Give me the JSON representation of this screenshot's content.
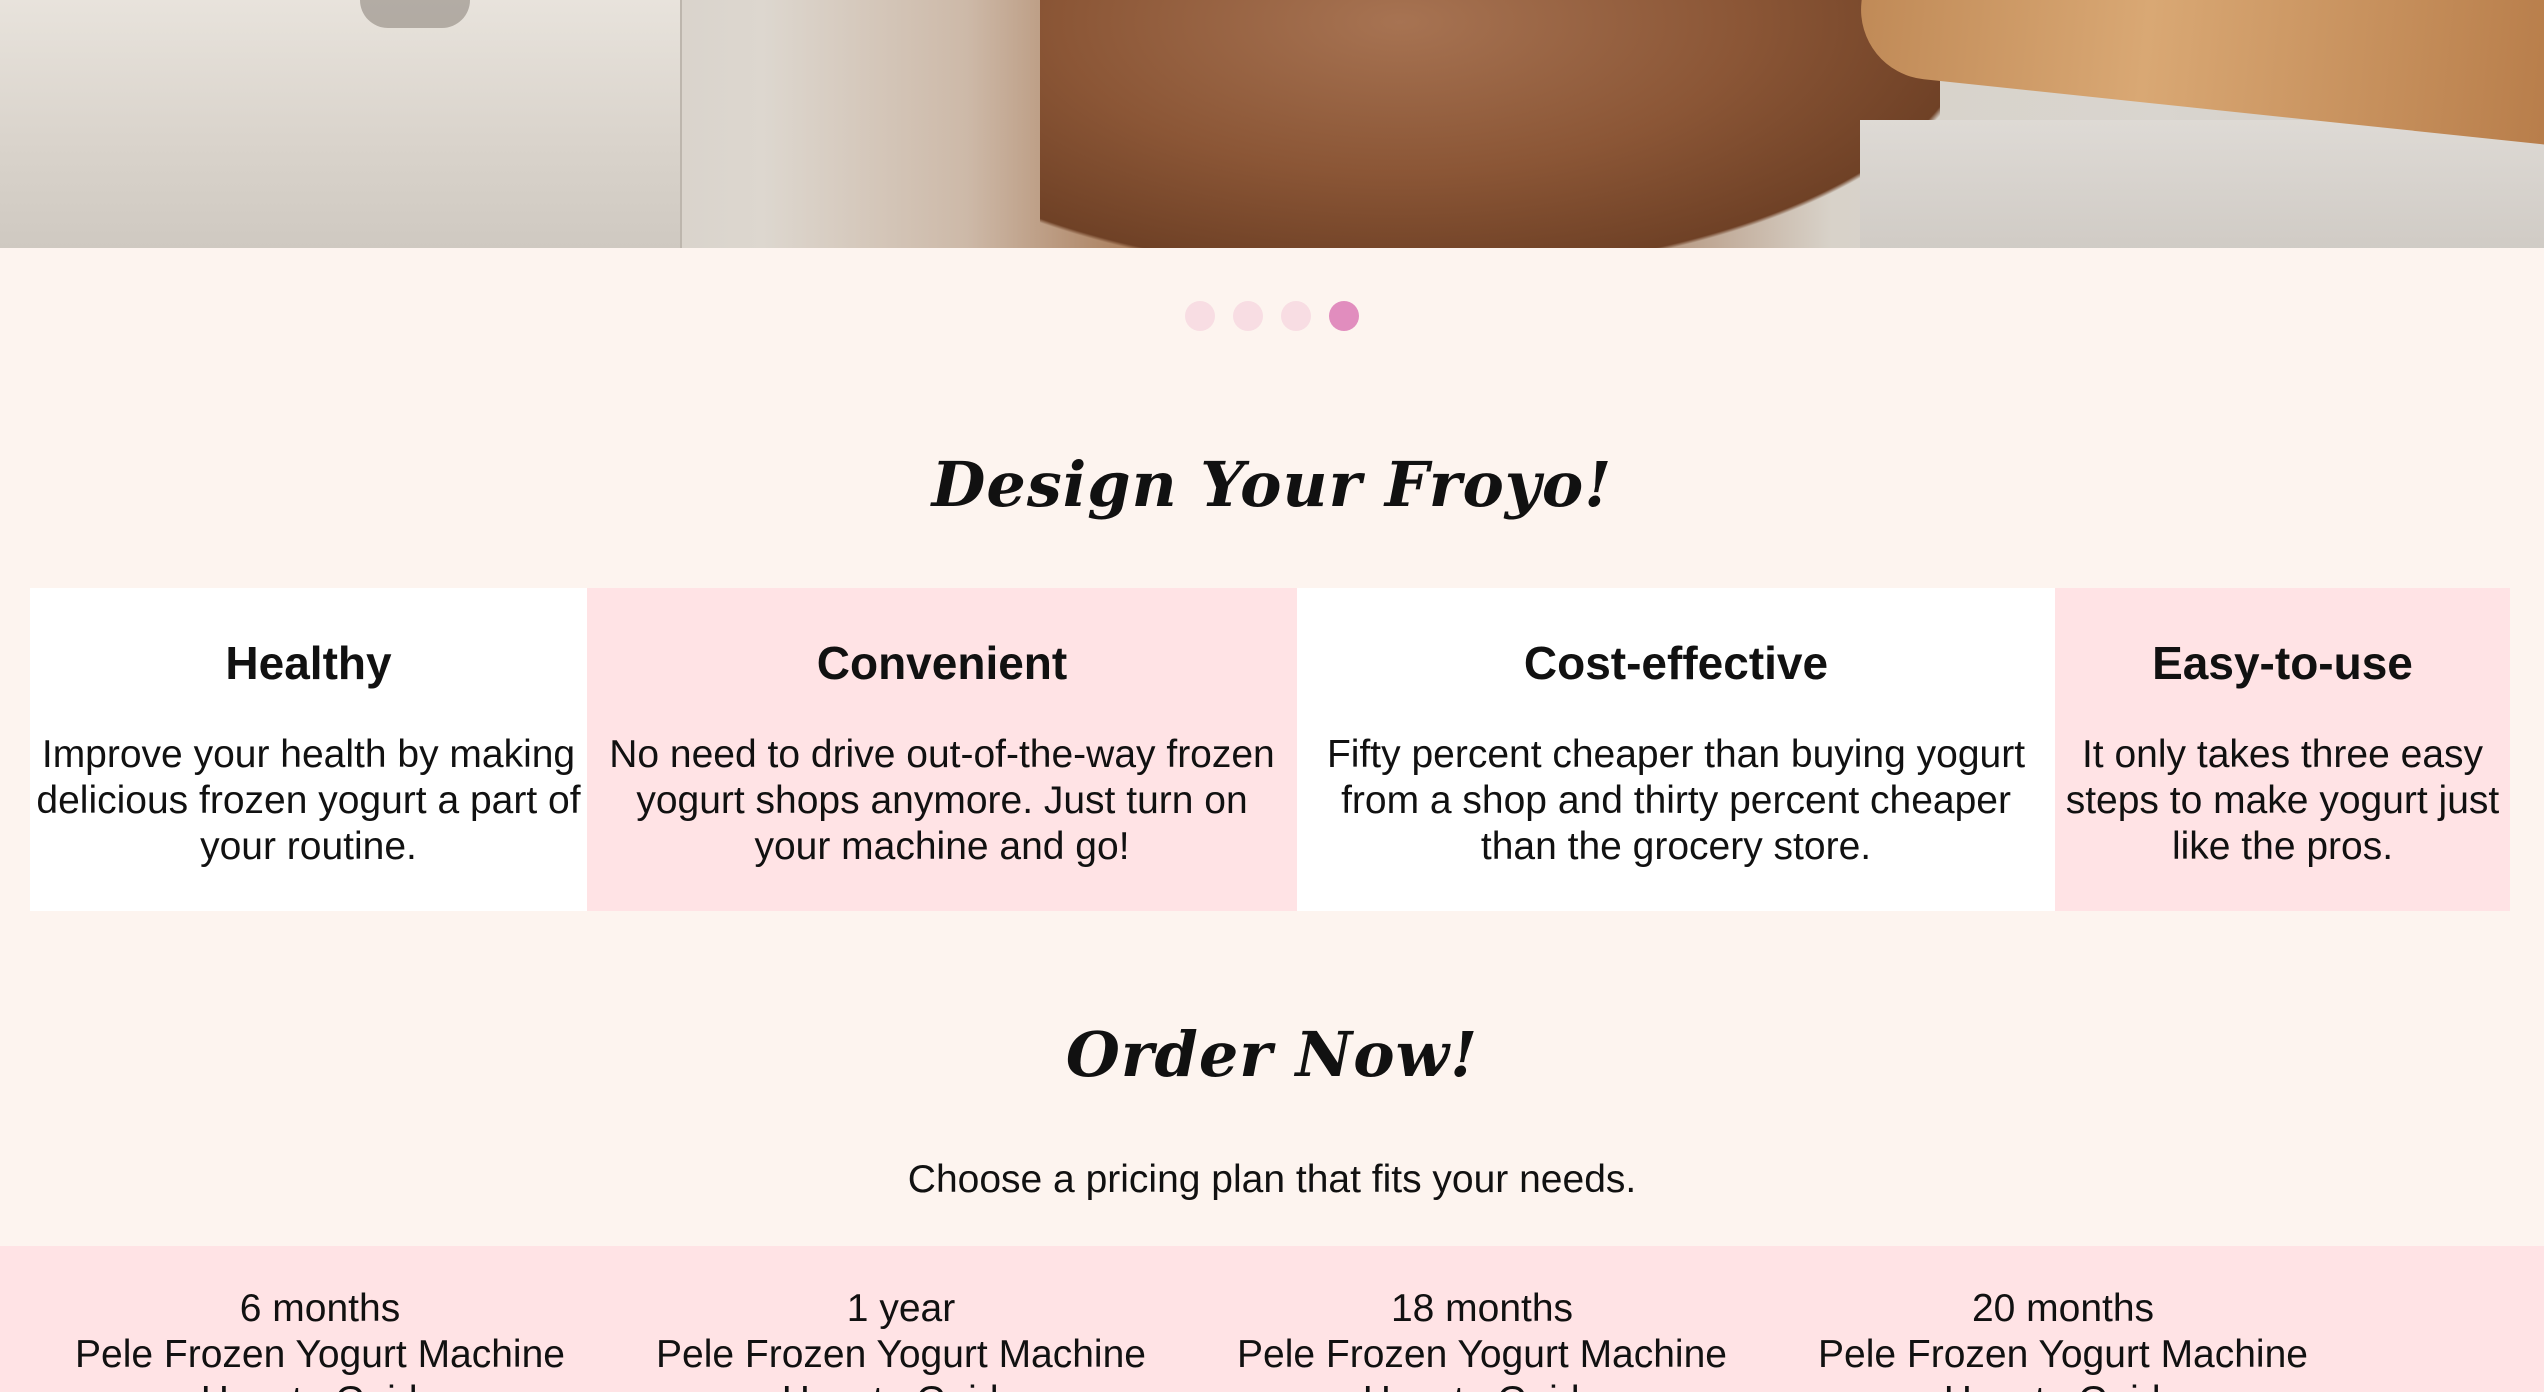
{
  "carousel": {
    "slides": 4,
    "active_index": 3,
    "colors": {
      "dot": "#f8dde3",
      "active_dot": "#e18dbe"
    }
  },
  "design_section": {
    "title": "Design Your Froyo!",
    "features": [
      {
        "title": "Healthy",
        "text": "Improve your health by making delicious frozen yogurt a part of your routine."
      },
      {
        "title": "Convenient",
        "text": "No need to drive out-of-the-way frozen yogurt shops anymore. Just turn on your machine and go!"
      },
      {
        "title": "Cost-effective",
        "text": "Fifty percent cheaper than buying yogurt from a shop and thirty percent cheaper than the grocery store."
      },
      {
        "title": "Easy-to-use",
        "text": "It only takes three easy steps to make yogurt just like the pros."
      }
    ]
  },
  "order_section": {
    "title": "Order Now!",
    "subtitle": "Choose a pricing plan that fits your needs.",
    "plans": [
      {
        "duration": "6 months",
        "product": "Pele Frozen Yogurt Machine",
        "extra": "How-to Guide"
      },
      {
        "duration": "1 year",
        "product": "Pele Frozen Yogurt Machine",
        "extra": "How-to Guide"
      },
      {
        "duration": "18 months",
        "product": "Pele Frozen Yogurt Machine",
        "extra": "How-to Guide"
      },
      {
        "duration": "20 months",
        "product": "Pele Frozen Yogurt Machine",
        "extra": "How-to Guide"
      }
    ]
  },
  "colors": {
    "page_background": "#fdf4ef",
    "pink_panel": "#ffe3e5",
    "white_panel": "#ffffff"
  }
}
